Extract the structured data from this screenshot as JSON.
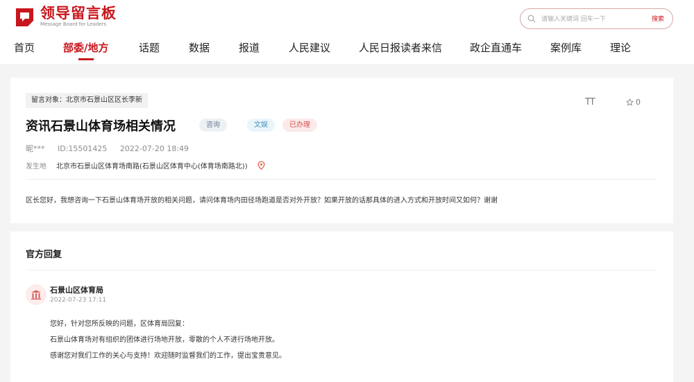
{
  "brand": {
    "name": "领导留言板",
    "subtitle": "Message Board for Leaders",
    "color": "#c8161d"
  },
  "search": {
    "placeholder": "请输入关键词 回车一下",
    "button_label": "搜索"
  },
  "nav": {
    "items": [
      "首页",
      "部委/地方",
      "话题",
      "数据",
      "报道",
      "人民建议",
      "人民日报读者来信",
      "政企直通车",
      "案例库",
      "理论"
    ],
    "active_index": 1
  },
  "message": {
    "target": "留言对象：北京市石景山区区长李新",
    "font_toggle": "TT",
    "favorite_count": "0",
    "title": "资讯石景山体育场相关情况",
    "badges": {
      "type": "咨询",
      "category": "文娱",
      "status": "已办理"
    },
    "author": "昵***",
    "id": "ID:15501425",
    "datetime": "2022-07-20 18:49",
    "location_label": "发生地",
    "location": "北京市石景山区体育场南路(石景山区体育中心(体育场南路北))",
    "body": "区长您好，我想咨询一下石景山体育场开放的相关问题，请问体育场内田径场跑道是否对外开放？如果开放的话那具体的进入方式和开放时间又如何？谢谢"
  },
  "reply": {
    "heading": "官方回复",
    "org": "石景山区体育局",
    "datetime": "2022-07-23 17:11",
    "lines": [
      "您好，针对您所反映的问题，区体育局回复：",
      "石景山体育场对有组织的团体进行场地开放，零散的个人不进行场地开放。",
      "感谢您对我们工作的关心与支持！欢迎随时监督我们的工作，提出宝贵意见。"
    ]
  }
}
